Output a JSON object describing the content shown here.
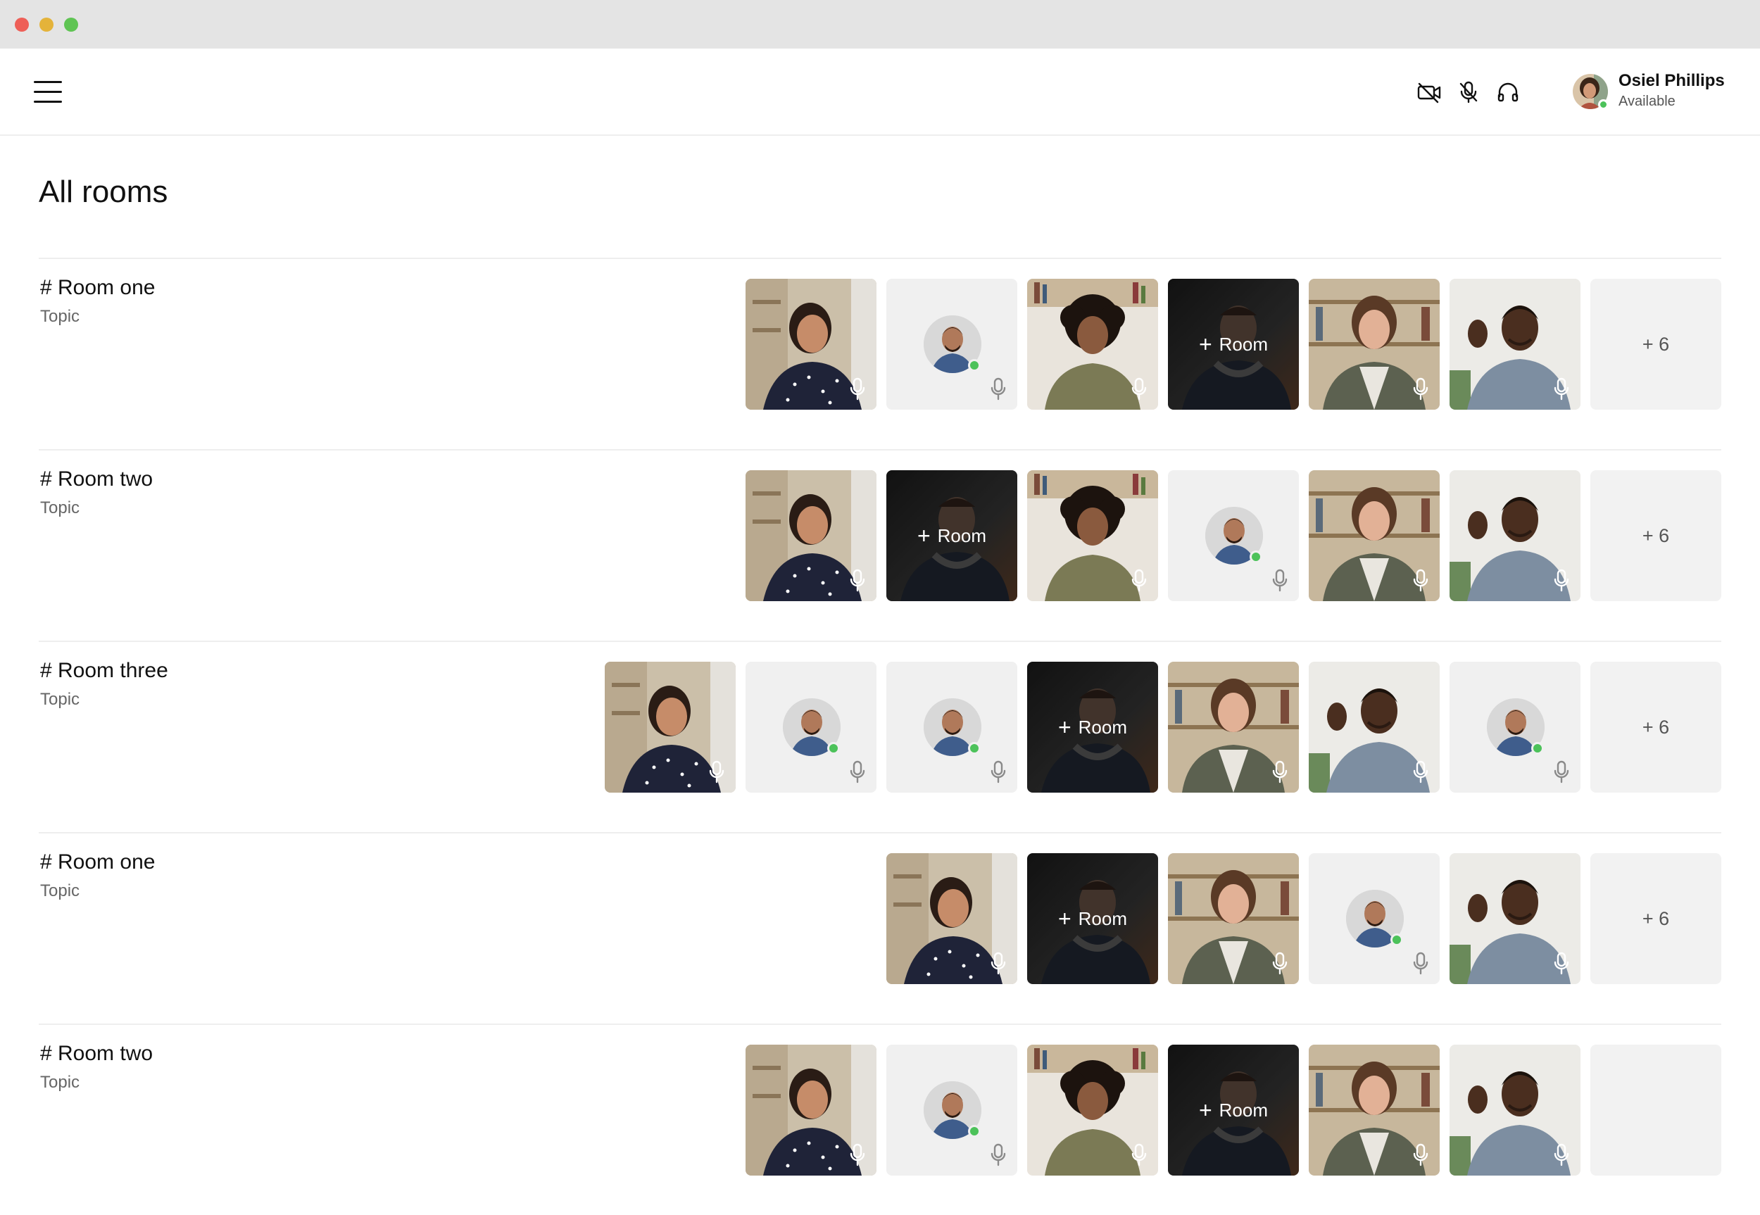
{
  "window": {
    "controls": [
      "close",
      "minimize",
      "maximize"
    ]
  },
  "header": {
    "menu_icon": "hamburger-menu-icon",
    "tools": [
      {
        "name": "camera-off-button",
        "icon": "video-off-icon"
      },
      {
        "name": "mic-off-button",
        "icon": "mic-off-icon"
      },
      {
        "name": "headphones-button",
        "icon": "headphones-icon"
      }
    ],
    "user": {
      "name": "Osiel Phillips",
      "status": "Available",
      "status_color": "#4cc25a"
    }
  },
  "page": {
    "title": "All rooms"
  },
  "colors": {
    "online": "#4cc25a",
    "tile_bg": "#f0f0f0",
    "mic_light": "#ffffff",
    "mic_muted": "#8a8a8a"
  },
  "rooms": [
    {
      "name": "# Room one",
      "topic": "Topic",
      "tiles": [
        {
          "type": "video",
          "person": "woman-polka-dot"
        },
        {
          "type": "avatar"
        },
        {
          "type": "video",
          "person": "woman-curly"
        },
        {
          "type": "room",
          "label": "Room"
        },
        {
          "type": "video",
          "person": "woman-cardigan"
        },
        {
          "type": "video",
          "person": "man-waving"
        }
      ],
      "more": "+ 6"
    },
    {
      "name": "# Room two",
      "topic": "Topic",
      "tiles": [
        {
          "type": "video",
          "person": "woman-polka-dot"
        },
        {
          "type": "room",
          "label": "Room"
        },
        {
          "type": "video",
          "person": "woman-curly"
        },
        {
          "type": "avatar"
        },
        {
          "type": "video",
          "person": "woman-cardigan"
        },
        {
          "type": "video",
          "person": "man-waving"
        }
      ],
      "more": "+ 6"
    },
    {
      "name": "# Room three",
      "topic": "Topic",
      "tiles": [
        {
          "type": "video",
          "person": "woman-polka-dot"
        },
        {
          "type": "avatar"
        },
        {
          "type": "avatar"
        },
        {
          "type": "room",
          "label": "Room"
        },
        {
          "type": "video",
          "person": "woman-cardigan"
        },
        {
          "type": "video",
          "person": "man-waving"
        },
        {
          "type": "avatar"
        }
      ],
      "more": "+ 6"
    },
    {
      "name": "# Room one",
      "topic": "Topic",
      "tiles": [
        {
          "type": "video",
          "person": "woman-polka-dot"
        },
        {
          "type": "room",
          "label": "Room"
        },
        {
          "type": "video",
          "person": "woman-cardigan"
        },
        {
          "type": "avatar"
        },
        {
          "type": "video",
          "person": "man-waving"
        }
      ],
      "more": "+ 6"
    },
    {
      "name": "# Room two",
      "topic": "Topic",
      "tiles": [
        {
          "type": "video",
          "person": "woman-polka-dot"
        },
        {
          "type": "avatar"
        },
        {
          "type": "video",
          "person": "woman-curly"
        },
        {
          "type": "room",
          "label": "Room"
        },
        {
          "type": "video",
          "person": "woman-cardigan"
        },
        {
          "type": "video",
          "person": "man-waving"
        }
      ],
      "more": ""
    }
  ]
}
